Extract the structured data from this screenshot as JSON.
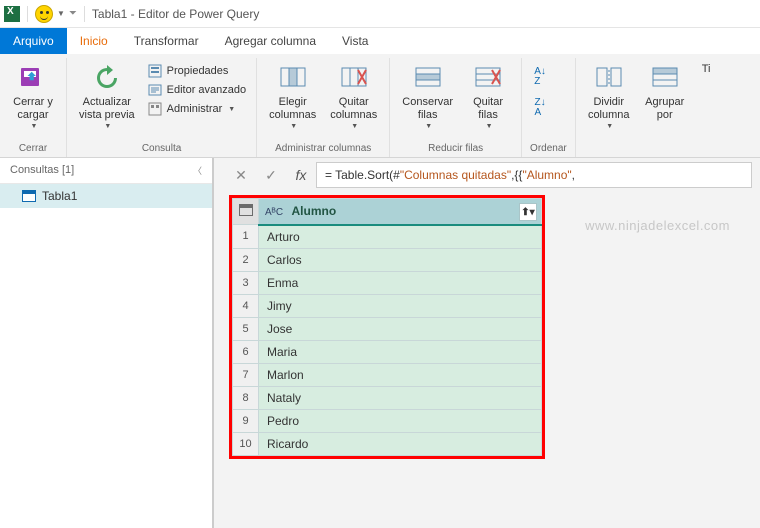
{
  "window": {
    "title": "Tabla1 - Editor de Power Query"
  },
  "tabs": {
    "arquivo": "Arquivo",
    "inicio": "Inicio",
    "transformar": "Transformar",
    "agregar": "Agregar columna",
    "vista": "Vista"
  },
  "ribbon": {
    "cerrar": {
      "label": "Cerrar y\ncargar",
      "group": "Cerrar"
    },
    "actualizar": {
      "label": "Actualizar\nvista previa",
      "propiedades": "Propiedades",
      "editor": "Editor avanzado",
      "administrar": "Administrar",
      "group": "Consulta"
    },
    "columnas": {
      "elegir": "Elegir\ncolumnas",
      "quitar": "Quitar\ncolumnas",
      "group": "Administrar columnas"
    },
    "filas": {
      "conservar": "Conservar\nfilas",
      "quitar": "Quitar\nfilas",
      "group": "Reducir filas"
    },
    "ordenar": {
      "group": "Ordenar"
    },
    "dividir": {
      "dividir": "Dividir\ncolumna",
      "agrupar": "Agrupar\npor",
      "ti": "Ti"
    }
  },
  "sidebar": {
    "header": "Consultas [1]",
    "item": "Tabla1"
  },
  "formula": {
    "prefix": "= Table.Sort(#",
    "str1": "\"Columnas quitadas\"",
    "mid": ",{{",
    "str2": "\"Alumno\"",
    "suffix": ","
  },
  "watermark": "www.ninjadelexcel.com",
  "table": {
    "type_icon": "AᴮC",
    "column": "Alumno",
    "rows": [
      "Arturo",
      "Carlos",
      "Enma",
      "Jimy",
      "Jose",
      "Maria",
      "Marlon",
      "Nataly",
      "Pedro",
      "Ricardo"
    ]
  },
  "chart_data": {
    "type": "table",
    "columns": [
      "Alumno"
    ],
    "rows": [
      [
        "Arturo"
      ],
      [
        "Carlos"
      ],
      [
        "Enma"
      ],
      [
        "Jimy"
      ],
      [
        "Jose"
      ],
      [
        "Maria"
      ],
      [
        "Marlon"
      ],
      [
        "Nataly"
      ],
      [
        "Pedro"
      ],
      [
        "Ricardo"
      ]
    ]
  }
}
